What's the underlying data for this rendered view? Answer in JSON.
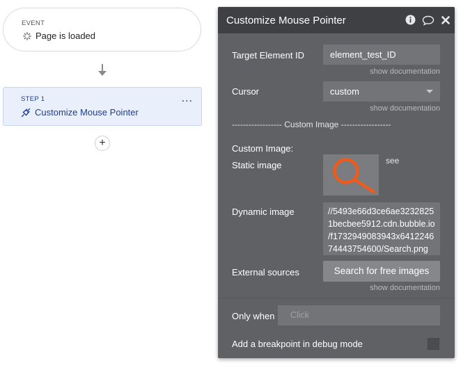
{
  "event": {
    "kicker": "EVENT",
    "title": "Page is loaded",
    "icon": "spinner-icon"
  },
  "step": {
    "kicker": "STEP 1",
    "title": "Customize Mouse Pointer",
    "icon": "plug-icon",
    "menu": "..."
  },
  "add_step": {
    "label": "+"
  },
  "panel": {
    "title": "Customize Mouse Pointer",
    "header_icons": [
      "info-icon",
      "comment-icon",
      "close-icon"
    ],
    "target_label": "Target Element ID",
    "target_value": "element_test_ID",
    "doc_link": "show documentation",
    "cursor_label": "Cursor",
    "cursor_value": "custom",
    "divider": "------------------ Custom Image ------------------",
    "custom_image_label": "Custom Image:",
    "static_label": "Static image",
    "see_label": "see",
    "dynamic_label": "Dynamic image",
    "dynamic_lines": [
      "//5493e66d3ce6ae3232825",
      "1becbee5912.cdn.bubble.io",
      "/f1732949083943x6412246",
      "74443754600/Search.png"
    ],
    "external_label": "External sources",
    "search_button": "Search for free images",
    "only_when_label": "Only when",
    "only_when_placeholder": "Click",
    "breakpoint_label": "Add a breakpoint in debug mode"
  },
  "colors": {
    "panel_bg": "#5f6165",
    "header_bg": "#3e4044",
    "accent": "#1d3d8f",
    "magnifier": "#f05a1a"
  }
}
